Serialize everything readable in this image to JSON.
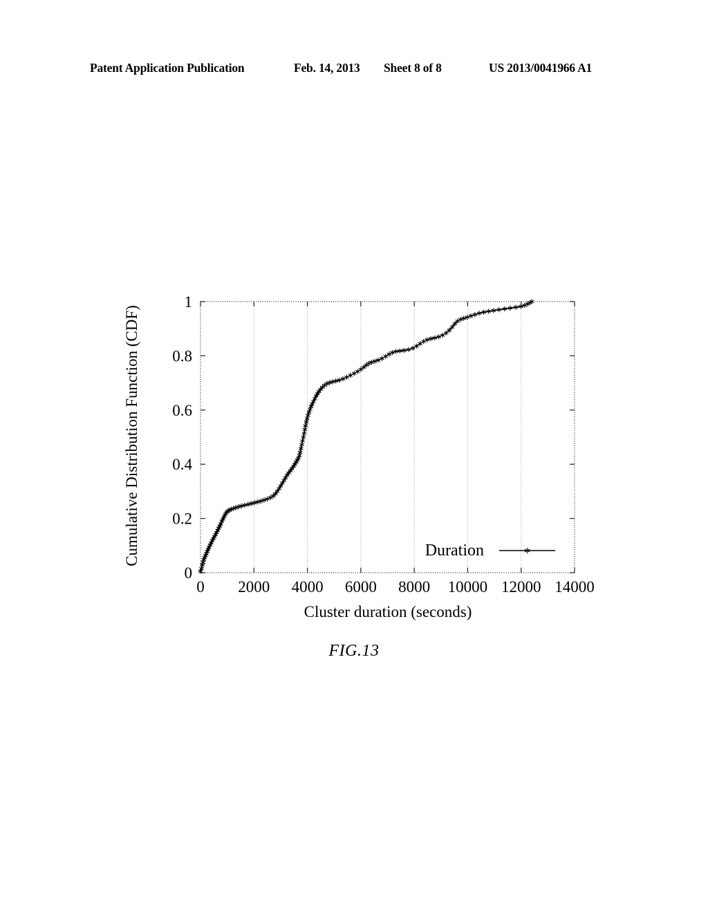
{
  "header": {
    "publication_label": "Patent Application Publication",
    "date": "Feb. 14, 2013",
    "sheet": "Sheet 8 of 8",
    "publication_number": "US 2013/0041966 A1"
  },
  "figure": {
    "caption": "FIG.13"
  },
  "chart_data": {
    "type": "line",
    "title": "",
    "xlabel": "Cluster duration (seconds)",
    "ylabel": "Cumulative Distribution Function (CDF)",
    "xlim": [
      0,
      14000
    ],
    "ylim": [
      0,
      1
    ],
    "xticks": [
      0,
      2000,
      4000,
      6000,
      8000,
      10000,
      12000,
      14000
    ],
    "xtick_labels": [
      "0",
      "2000",
      "4000",
      "6000",
      "8000",
      "10000",
      "12000",
      "14000"
    ],
    "yticks": [
      0,
      0.2,
      0.4,
      0.6,
      0.8,
      1
    ],
    "ytick_labels": [
      "0",
      "0.2",
      "0.4",
      "0.6",
      "0.8",
      "1"
    ],
    "grid": true,
    "grid_style": "dotted",
    "gridlines_x": [
      2000,
      4000,
      6000,
      8000,
      10000,
      12000,
      14000
    ],
    "legend": {
      "position": "bottom-right",
      "entries": [
        {
          "name": "Duration",
          "marker": "star",
          "line": "solid",
          "color": "#000000"
        }
      ]
    },
    "series": [
      {
        "name": "Duration",
        "marker": "star",
        "color": "#000000",
        "points": [
          [
            0,
            0.005
          ],
          [
            40,
            0.015
          ],
          [
            70,
            0.028
          ],
          [
            95,
            0.038
          ],
          [
            120,
            0.048
          ],
          [
            150,
            0.055
          ],
          [
            185,
            0.062
          ],
          [
            215,
            0.07
          ],
          [
            250,
            0.078
          ],
          [
            285,
            0.086
          ],
          [
            320,
            0.094
          ],
          [
            360,
            0.102
          ],
          [
            400,
            0.11
          ],
          [
            440,
            0.118
          ],
          [
            480,
            0.126
          ],
          [
            520,
            0.133
          ],
          [
            560,
            0.14
          ],
          [
            600,
            0.148
          ],
          [
            640,
            0.156
          ],
          [
            680,
            0.164
          ],
          [
            720,
            0.172
          ],
          [
            760,
            0.18
          ],
          [
            800,
            0.19
          ],
          [
            840,
            0.198
          ],
          [
            880,
            0.206
          ],
          [
            915,
            0.213
          ],
          [
            950,
            0.219
          ],
          [
            990,
            0.224
          ],
          [
            1040,
            0.228
          ],
          [
            1090,
            0.231
          ],
          [
            1150,
            0.234
          ],
          [
            1230,
            0.237
          ],
          [
            1320,
            0.24
          ],
          [
            1420,
            0.243
          ],
          [
            1530,
            0.246
          ],
          [
            1650,
            0.249
          ],
          [
            1780,
            0.252
          ],
          [
            1900,
            0.255
          ],
          [
            2020,
            0.258
          ],
          [
            2140,
            0.261
          ],
          [
            2260,
            0.264
          ],
          [
            2380,
            0.268
          ],
          [
            2500,
            0.272
          ],
          [
            2620,
            0.277
          ],
          [
            2720,
            0.283
          ],
          [
            2800,
            0.291
          ],
          [
            2870,
            0.3
          ],
          [
            2940,
            0.31
          ],
          [
            3000,
            0.32
          ],
          [
            3060,
            0.33
          ],
          [
            3120,
            0.34
          ],
          [
            3180,
            0.35
          ],
          [
            3240,
            0.36
          ],
          [
            3300,
            0.368
          ],
          [
            3360,
            0.376
          ],
          [
            3420,
            0.384
          ],
          [
            3480,
            0.392
          ],
          [
            3530,
            0.4
          ],
          [
            3580,
            0.408
          ],
          [
            3620,
            0.415
          ],
          [
            3660,
            0.422
          ],
          [
            3700,
            0.432
          ],
          [
            3730,
            0.444
          ],
          [
            3760,
            0.458
          ],
          [
            3790,
            0.472
          ],
          [
            3820,
            0.486
          ],
          [
            3850,
            0.5
          ],
          [
            3880,
            0.514
          ],
          [
            3905,
            0.528
          ],
          [
            3930,
            0.542
          ],
          [
            3960,
            0.556
          ],
          [
            3990,
            0.568
          ],
          [
            4020,
            0.58
          ],
          [
            4060,
            0.592
          ],
          [
            4100,
            0.603
          ],
          [
            4140,
            0.613
          ],
          [
            4180,
            0.622
          ],
          [
            4230,
            0.632
          ],
          [
            4280,
            0.642
          ],
          [
            4330,
            0.652
          ],
          [
            4380,
            0.66
          ],
          [
            4430,
            0.668
          ],
          [
            4490,
            0.676
          ],
          [
            4560,
            0.684
          ],
          [
            4640,
            0.691
          ],
          [
            4730,
            0.697
          ],
          [
            4830,
            0.701
          ],
          [
            4940,
            0.704
          ],
          [
            5060,
            0.707
          ],
          [
            5190,
            0.71
          ],
          [
            5330,
            0.715
          ],
          [
            5470,
            0.721
          ],
          [
            5610,
            0.728
          ],
          [
            5750,
            0.735
          ],
          [
            5880,
            0.742
          ],
          [
            6000,
            0.75
          ],
          [
            6110,
            0.758
          ],
          [
            6210,
            0.766
          ],
          [
            6300,
            0.772
          ],
          [
            6400,
            0.776
          ],
          [
            6520,
            0.78
          ],
          [
            6650,
            0.784
          ],
          [
            6790,
            0.79
          ],
          [
            6930,
            0.798
          ],
          [
            7060,
            0.806
          ],
          [
            7180,
            0.812
          ],
          [
            7310,
            0.816
          ],
          [
            7460,
            0.818
          ],
          [
            7620,
            0.82
          ],
          [
            7790,
            0.823
          ],
          [
            7950,
            0.828
          ],
          [
            8090,
            0.836
          ],
          [
            8220,
            0.845
          ],
          [
            8350,
            0.853
          ],
          [
            8480,
            0.859
          ],
          [
            8620,
            0.863
          ],
          [
            8770,
            0.866
          ],
          [
            8920,
            0.87
          ],
          [
            9060,
            0.876
          ],
          [
            9190,
            0.884
          ],
          [
            9310,
            0.894
          ],
          [
            9420,
            0.906
          ],
          [
            9520,
            0.918
          ],
          [
            9620,
            0.928
          ],
          [
            9730,
            0.934
          ],
          [
            9850,
            0.938
          ],
          [
            9980,
            0.942
          ],
          [
            10120,
            0.947
          ],
          [
            10270,
            0.952
          ],
          [
            10430,
            0.957
          ],
          [
            10600,
            0.961
          ],
          [
            10780,
            0.964
          ],
          [
            10970,
            0.967
          ],
          [
            11170,
            0.97
          ],
          [
            11380,
            0.973
          ],
          [
            11590,
            0.976
          ],
          [
            11800,
            0.979
          ],
          [
            11990,
            0.982
          ],
          [
            12130,
            0.986
          ],
          [
            12240,
            0.991
          ],
          [
            12330,
            0.996
          ],
          [
            12400,
            1.0
          ]
        ]
      }
    ]
  }
}
